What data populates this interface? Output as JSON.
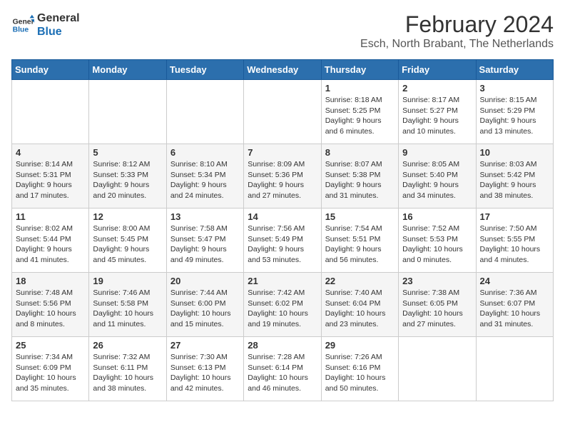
{
  "logo": {
    "line1": "General",
    "line2": "Blue"
  },
  "title": "February 2024",
  "location": "Esch, North Brabant, The Netherlands",
  "days_of_week": [
    "Sunday",
    "Monday",
    "Tuesday",
    "Wednesday",
    "Thursday",
    "Friday",
    "Saturday"
  ],
  "weeks": [
    [
      {
        "day": "",
        "text": ""
      },
      {
        "day": "",
        "text": ""
      },
      {
        "day": "",
        "text": ""
      },
      {
        "day": "",
        "text": ""
      },
      {
        "day": "1",
        "text": "Sunrise: 8:18 AM\nSunset: 5:25 PM\nDaylight: 9 hours\nand 6 minutes."
      },
      {
        "day": "2",
        "text": "Sunrise: 8:17 AM\nSunset: 5:27 PM\nDaylight: 9 hours\nand 10 minutes."
      },
      {
        "day": "3",
        "text": "Sunrise: 8:15 AM\nSunset: 5:29 PM\nDaylight: 9 hours\nand 13 minutes."
      }
    ],
    [
      {
        "day": "4",
        "text": "Sunrise: 8:14 AM\nSunset: 5:31 PM\nDaylight: 9 hours\nand 17 minutes."
      },
      {
        "day": "5",
        "text": "Sunrise: 8:12 AM\nSunset: 5:33 PM\nDaylight: 9 hours\nand 20 minutes."
      },
      {
        "day": "6",
        "text": "Sunrise: 8:10 AM\nSunset: 5:34 PM\nDaylight: 9 hours\nand 24 minutes."
      },
      {
        "day": "7",
        "text": "Sunrise: 8:09 AM\nSunset: 5:36 PM\nDaylight: 9 hours\nand 27 minutes."
      },
      {
        "day": "8",
        "text": "Sunrise: 8:07 AM\nSunset: 5:38 PM\nDaylight: 9 hours\nand 31 minutes."
      },
      {
        "day": "9",
        "text": "Sunrise: 8:05 AM\nSunset: 5:40 PM\nDaylight: 9 hours\nand 34 minutes."
      },
      {
        "day": "10",
        "text": "Sunrise: 8:03 AM\nSunset: 5:42 PM\nDaylight: 9 hours\nand 38 minutes."
      }
    ],
    [
      {
        "day": "11",
        "text": "Sunrise: 8:02 AM\nSunset: 5:44 PM\nDaylight: 9 hours\nand 41 minutes."
      },
      {
        "day": "12",
        "text": "Sunrise: 8:00 AM\nSunset: 5:45 PM\nDaylight: 9 hours\nand 45 minutes."
      },
      {
        "day": "13",
        "text": "Sunrise: 7:58 AM\nSunset: 5:47 PM\nDaylight: 9 hours\nand 49 minutes."
      },
      {
        "day": "14",
        "text": "Sunrise: 7:56 AM\nSunset: 5:49 PM\nDaylight: 9 hours\nand 53 minutes."
      },
      {
        "day": "15",
        "text": "Sunrise: 7:54 AM\nSunset: 5:51 PM\nDaylight: 9 hours\nand 56 minutes."
      },
      {
        "day": "16",
        "text": "Sunrise: 7:52 AM\nSunset: 5:53 PM\nDaylight: 10 hours\nand 0 minutes."
      },
      {
        "day": "17",
        "text": "Sunrise: 7:50 AM\nSunset: 5:55 PM\nDaylight: 10 hours\nand 4 minutes."
      }
    ],
    [
      {
        "day": "18",
        "text": "Sunrise: 7:48 AM\nSunset: 5:56 PM\nDaylight: 10 hours\nand 8 minutes."
      },
      {
        "day": "19",
        "text": "Sunrise: 7:46 AM\nSunset: 5:58 PM\nDaylight: 10 hours\nand 11 minutes."
      },
      {
        "day": "20",
        "text": "Sunrise: 7:44 AM\nSunset: 6:00 PM\nDaylight: 10 hours\nand 15 minutes."
      },
      {
        "day": "21",
        "text": "Sunrise: 7:42 AM\nSunset: 6:02 PM\nDaylight: 10 hours\nand 19 minutes."
      },
      {
        "day": "22",
        "text": "Sunrise: 7:40 AM\nSunset: 6:04 PM\nDaylight: 10 hours\nand 23 minutes."
      },
      {
        "day": "23",
        "text": "Sunrise: 7:38 AM\nSunset: 6:05 PM\nDaylight: 10 hours\nand 27 minutes."
      },
      {
        "day": "24",
        "text": "Sunrise: 7:36 AM\nSunset: 6:07 PM\nDaylight: 10 hours\nand 31 minutes."
      }
    ],
    [
      {
        "day": "25",
        "text": "Sunrise: 7:34 AM\nSunset: 6:09 PM\nDaylight: 10 hours\nand 35 minutes."
      },
      {
        "day": "26",
        "text": "Sunrise: 7:32 AM\nSunset: 6:11 PM\nDaylight: 10 hours\nand 38 minutes."
      },
      {
        "day": "27",
        "text": "Sunrise: 7:30 AM\nSunset: 6:13 PM\nDaylight: 10 hours\nand 42 minutes."
      },
      {
        "day": "28",
        "text": "Sunrise: 7:28 AM\nSunset: 6:14 PM\nDaylight: 10 hours\nand 46 minutes."
      },
      {
        "day": "29",
        "text": "Sunrise: 7:26 AM\nSunset: 6:16 PM\nDaylight: 10 hours\nand 50 minutes."
      },
      {
        "day": "",
        "text": ""
      },
      {
        "day": "",
        "text": ""
      }
    ]
  ]
}
